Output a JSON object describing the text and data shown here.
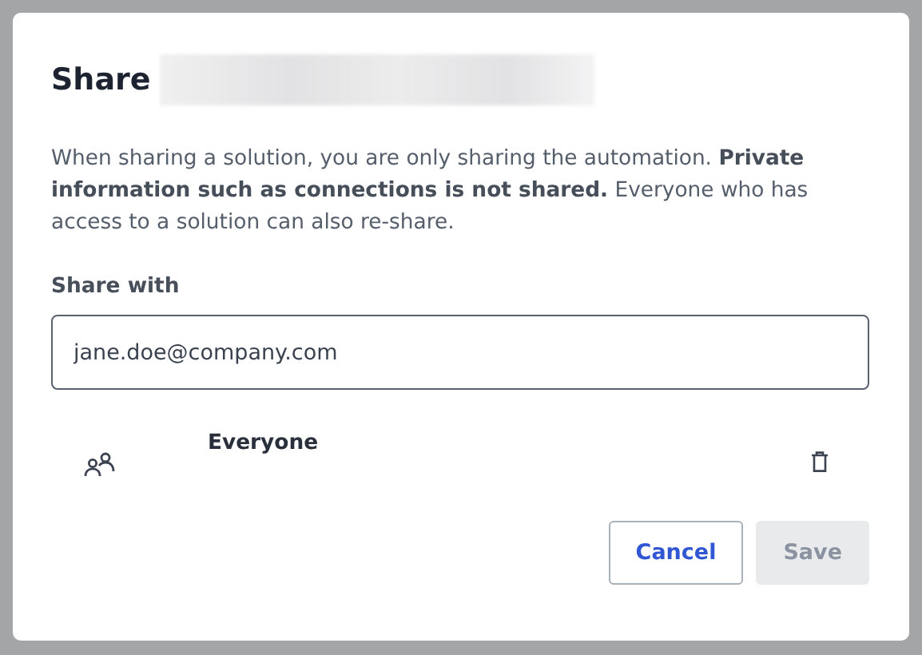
{
  "dialog": {
    "title": "Share",
    "description": "When sharing a solution, you are only sharing the automation. **Private information such as connections is not shared.** Everyone who has access to a solution can also re-share.",
    "share_with": {
      "label": "Share with",
      "value": "jane.doe@company.com"
    },
    "members": [
      {
        "name": "Everyone",
        "kind": "group"
      }
    ],
    "buttons": [
      {
        "label": "Cancel",
        "kind": "secondary",
        "disabled": false
      },
      {
        "label": "Save",
        "kind": "primary",
        "disabled": true
      }
    ]
  }
}
